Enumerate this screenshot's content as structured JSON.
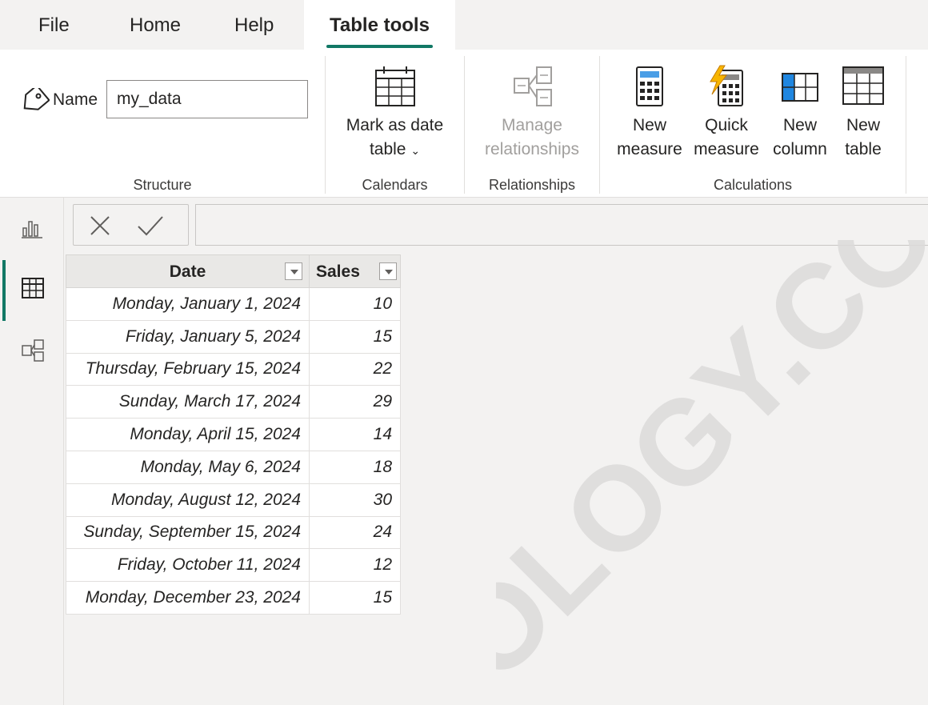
{
  "menu": {
    "file": "File",
    "home": "Home",
    "help": "Help",
    "table_tools": "Table tools"
  },
  "ribbon": {
    "structure": {
      "name_label": "Name",
      "name_value": "my_data",
      "group_label": "Structure"
    },
    "calendars": {
      "mark_line1": "Mark as date",
      "mark_line2": "table",
      "group_label": "Calendars"
    },
    "relationships": {
      "manage_line1": "Manage",
      "manage_line2": "relationships",
      "group_label": "Relationships"
    },
    "calculations": {
      "new_measure_line1": "New",
      "new_measure_line2": "measure",
      "quick_measure_line1": "Quick",
      "quick_measure_line2": "measure",
      "new_column_line1": "New",
      "new_column_line2": "column",
      "new_table_line1": "New",
      "new_table_line2": "table",
      "group_label": "Calculations"
    }
  },
  "rail_icons": [
    "report-view-icon",
    "table-view-icon",
    "model-view-icon"
  ],
  "formula_bar": {
    "cancel_icon": "close-icon",
    "commit_icon": "check-icon",
    "value": ""
  },
  "table": {
    "columns": [
      "Date",
      "Sales"
    ],
    "rows": [
      [
        "Monday, January 1, 2024",
        "10"
      ],
      [
        "Friday, January 5, 2024",
        "15"
      ],
      [
        "Thursday, February 15, 2024",
        "22"
      ],
      [
        "Sunday, March 17, 2024",
        "29"
      ],
      [
        "Monday, April 15, 2024",
        "14"
      ],
      [
        "Monday, May 6, 2024",
        "18"
      ],
      [
        "Monday, August 12, 2024",
        "30"
      ],
      [
        "Sunday, September 15, 2024",
        "24"
      ],
      [
        "Friday, October 11, 2024",
        "12"
      ],
      [
        "Monday, December 23, 2024",
        "15"
      ]
    ]
  },
  "colors": {
    "accent": "#117865",
    "watermark": "#dcdbda"
  },
  "watermark": "OLOGY.COM"
}
